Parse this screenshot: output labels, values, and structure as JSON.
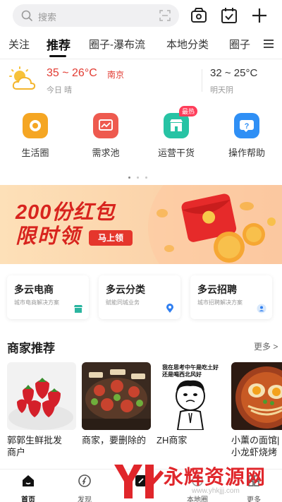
{
  "search": {
    "placeholder": "搜索"
  },
  "header_icons": [
    "wallet-icon",
    "calendar-check-icon",
    "plus-icon"
  ],
  "tabs": [
    {
      "label": "关注"
    },
    {
      "label": "推荐",
      "active": true
    },
    {
      "label": "圈子-瀑布流"
    },
    {
      "label": "本地分类"
    },
    {
      "label": "圈子"
    }
  ],
  "weather": {
    "today_temp": "35 ~ 26°C",
    "city": "南京",
    "today_desc": "今日 晴",
    "tomorrow_temp": "32 ~ 25°C",
    "tomorrow_desc": "明天阴"
  },
  "quick_actions": [
    {
      "label": "生活圈",
      "color": "#f5a623"
    },
    {
      "label": "需求池",
      "color": "#ee5a4f"
    },
    {
      "label": "运营干货",
      "color": "#27c3a4",
      "badge": "最热"
    },
    {
      "label": "操作帮助",
      "color": "#2f8ff5"
    }
  ],
  "carousel": {
    "page_count": 3,
    "active_index": 0
  },
  "banner": {
    "title": "200份红包",
    "subtitle": "限时领",
    "button": "马上领"
  },
  "feature_cards": [
    {
      "title": "多云电商",
      "desc": "城市电商解决方案"
    },
    {
      "title": "多云分类",
      "desc": "赋能同城业务"
    },
    {
      "title": "多云招聘",
      "desc": "城市招聘解决方案"
    }
  ],
  "merchants_section": {
    "title": "商家推荐",
    "more": "更多 >",
    "items": [
      {
        "name_line1": "郭郭生鲜批发",
        "name_line2": "商户"
      },
      {
        "name_line1": "商家，要删除的",
        "name_line2": ""
      },
      {
        "name_line1": "ZH商家",
        "name_line2": "",
        "meme_text_1": "我在思考中午是吃土好",
        "meme_text_2": "还是喝西北风好"
      },
      {
        "name_line1": "小薰の面馆|",
        "name_line2": "小龙虾烧烤"
      }
    ]
  },
  "bottom_nav": [
    {
      "label": "首页",
      "active": true
    },
    {
      "label": "发现"
    },
    {
      "label": ""
    },
    {
      "label": "本地圈"
    },
    {
      "label": "更多"
    }
  ],
  "watermark": {
    "brand": "永辉资源网",
    "url": "www.yhkjjj.com"
  },
  "colors": {
    "accent_red": "#e23b32",
    "banner_red": "#d8241e"
  }
}
